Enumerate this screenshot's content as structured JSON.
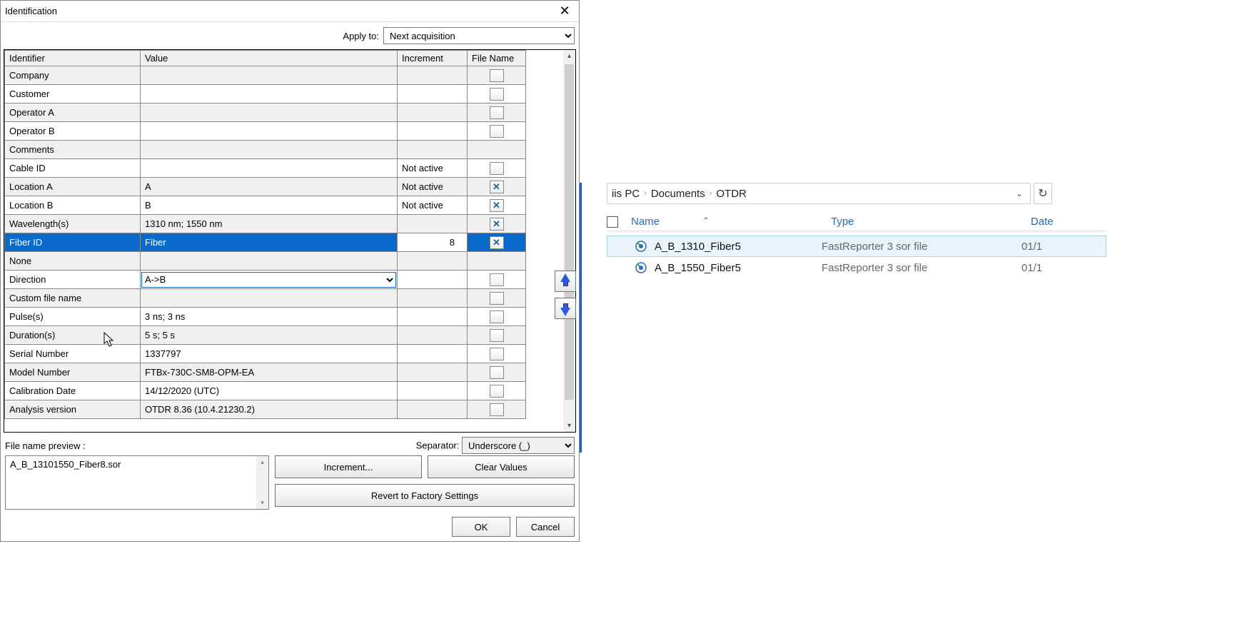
{
  "dialog": {
    "title": "Identification",
    "close": "✕",
    "applyTo": {
      "label": "Apply to:",
      "value": "Next acquisition"
    },
    "headers": {
      "identifier": "Identifier",
      "value": "Value",
      "increment": "Increment",
      "filename": "File Name"
    },
    "rows": [
      {
        "id": "Company",
        "val": "",
        "inc": "",
        "fn": "",
        "cls": "odd"
      },
      {
        "id": "Customer",
        "val": "",
        "inc": "",
        "fn": "",
        "cls": "even"
      },
      {
        "id": "Operator A",
        "val": "",
        "inc": "",
        "fn": "",
        "cls": "odd"
      },
      {
        "id": "Operator B",
        "val": "",
        "inc": "",
        "fn": "",
        "cls": "even"
      },
      {
        "id": "Comments",
        "val": "",
        "inc": "",
        "fn": "none",
        "cls": "odd"
      },
      {
        "id": "Cable ID",
        "val": "",
        "inc": "Not active",
        "fn": "",
        "cls": "even"
      },
      {
        "id": "Location A",
        "val": "A",
        "inc": "Not active",
        "fn": "x",
        "cls": "odd"
      },
      {
        "id": "Location B",
        "val": "B",
        "inc": "Not active",
        "fn": "x",
        "cls": "even"
      },
      {
        "id": "Wavelength(s)",
        "val": "1310 nm; 1550 nm",
        "inc": "",
        "fn": "x",
        "cls": "odd"
      },
      {
        "id": "Fiber ID",
        "val": "Fiber",
        "inc": "8",
        "fn": "x",
        "cls": "selected",
        "incInput": true
      },
      {
        "id": "None",
        "val": "",
        "inc": "",
        "fn": "none",
        "cls": "odd"
      },
      {
        "id": "Direction",
        "val": "A->B",
        "inc": "",
        "fn": "",
        "cls": "even",
        "select": true
      },
      {
        "id": "Custom file name",
        "val": "",
        "inc": "",
        "fn": "",
        "cls": "odd"
      },
      {
        "id": "Pulse(s)",
        "val": "3 ns; 3 ns",
        "inc": "",
        "fn": "",
        "cls": "even"
      },
      {
        "id": "Duration(s)",
        "val": "5 s; 5 s",
        "inc": "",
        "fn": "",
        "cls": "odd"
      },
      {
        "id": "Serial Number",
        "val": "1337797",
        "inc": "",
        "fn": "",
        "cls": "even"
      },
      {
        "id": "Model Number",
        "val": "FTBx-730C-SM8-OPM-EA",
        "inc": "",
        "fn": "",
        "cls": "odd"
      },
      {
        "id": "Calibration Date",
        "val": "14/12/2020 (UTC)",
        "inc": "",
        "fn": "",
        "cls": "even"
      },
      {
        "id": "Analysis version",
        "val": "OTDR 8.36 (10.4.21230.2)",
        "inc": "",
        "fn": "",
        "cls": "odd"
      }
    ],
    "previewLabel": "File name preview :",
    "separator": {
      "label": "Separator:",
      "value": "Underscore (_)"
    },
    "previewText": "A_B_13101550_Fiber8.sor",
    "buttons": {
      "increment": "Increment...",
      "clear": "Clear Values",
      "revert": "Revert to Factory Settings",
      "ok": "OK",
      "cancel": "Cancel"
    }
  },
  "explorer": {
    "breadcrumb": {
      "pc": "iis PC",
      "lvl1": "Documents",
      "lvl2": "OTDR"
    },
    "headers": {
      "name": "Name",
      "type": "Type",
      "date": "Date"
    },
    "files": [
      {
        "name": "A_B_1310_Fiber5",
        "type": "FastReporter 3 sor file",
        "date": "01/1",
        "sel": true
      },
      {
        "name": "A_B_1550_Fiber5",
        "type": "FastReporter 3 sor file",
        "date": "01/1",
        "sel": false
      }
    ]
  }
}
